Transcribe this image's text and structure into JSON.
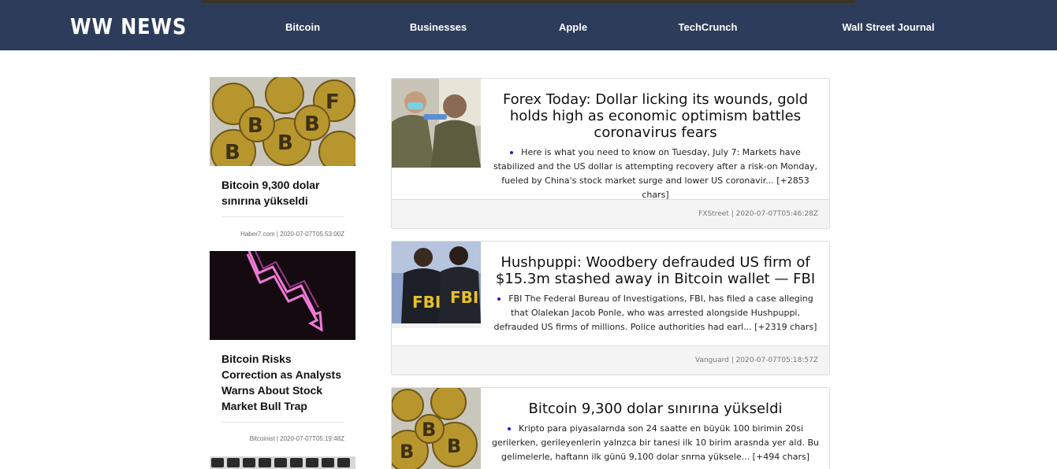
{
  "header": {
    "brand": "WW NEWS",
    "nav": [
      "Bitcoin",
      "Businesses",
      "Apple",
      "TechCrunch",
      "Wall Street Journal"
    ]
  },
  "sidebar": {
    "items": [
      {
        "title": "Bitcoin 9,300 dolar sınırına yükseldi",
        "meta": "Haber7.com | 2020-07-07T05:53:00Z",
        "image": "bitcoin-coins-image"
      },
      {
        "title": "Bitcoin Risks Correction as Analysts Warns About Stock Market Bull Trap",
        "meta": "Bitcoinist | 2020-07-07T05:19:48Z",
        "image": "neon-down-arrow-image"
      }
    ]
  },
  "articles": [
    {
      "title": "Forex Today: Dollar licking its wounds, gold holds high as economic optimism battles coronavirus fears",
      "description": "Here is what you need to know on Tuesday, July 7: Markets have stabilized and the US dollar is attempting recovery after a risk-on Monday, fueled by China's stock market surge and lower US coronavir... [+2853 chars]",
      "meta": "FXStreet | 2020-07-07T05:46:28Z",
      "image": "soldiers-masks-image"
    },
    {
      "title": "Hushpuppi: Woodbery defrauded US firm of $15.3m stashed away in Bitcoin wallet — FBI",
      "description": "FBI The Federal Bureau of Investigations, FBI, has filed a case alleging that Olalekan Jacob Ponle, who was arrested alongside Hushpuppi, defrauded US firms of millions. Police authorities had earl... [+2319 chars]",
      "meta": "Vanguard | 2020-07-07T05:18:57Z",
      "image": "fbi-agents-image"
    },
    {
      "title": "Bitcoin 9,300 dolar sınırına yükseldi",
      "description": "Kripto para piyasalarnda son 24 saatte en büyük 100 birimin 20si gerilerken, gerileyenlerin yalnzca bir tanesi ilk 10 birim arasnda yer ald. Bu gelimelerle, haftann ilk günü 9,100 dolar snrna yüksele... [+494 chars]",
      "meta": "",
      "image": "bitcoin-coins-image"
    }
  ],
  "colors": {
    "header_bg": "#2c3c5a",
    "footer_bg": "#f4f4f4",
    "bullet": "#1c1cd6"
  }
}
